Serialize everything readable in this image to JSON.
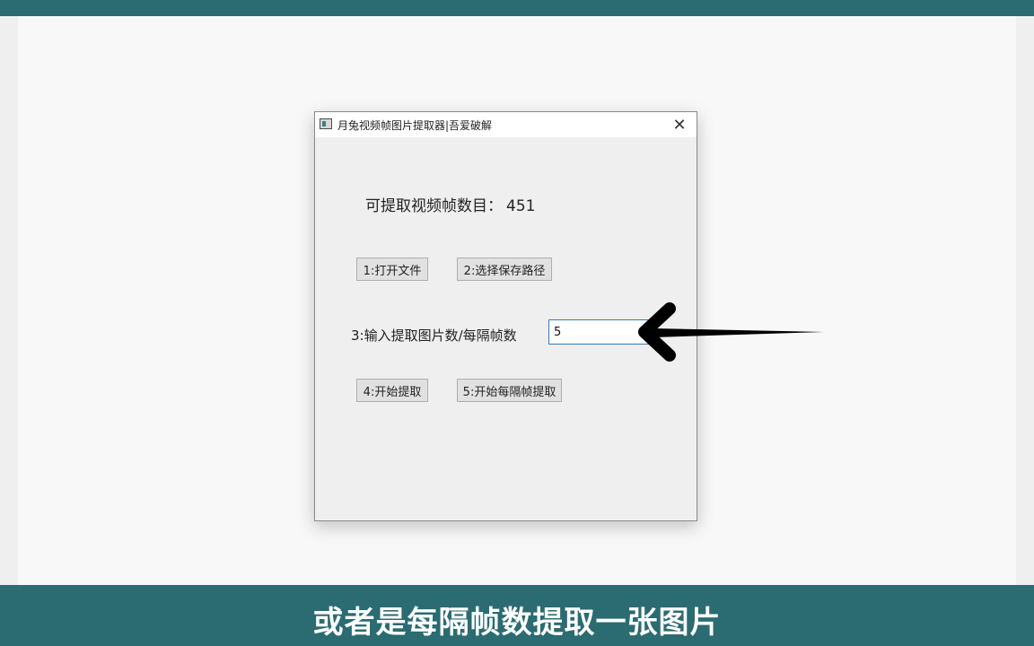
{
  "window": {
    "title": "月兔视频帧图片提取器|吾爱破解",
    "close_glyph": "✕"
  },
  "info": {
    "frame_count_label": "可提取视频帧数目：",
    "frame_count_value": "451"
  },
  "buttons": {
    "open_file": "1:打开文件",
    "select_save_path": "2:选择保存路径",
    "start_extract": "4:开始提取",
    "start_every_frame": "5:开始每隔帧提取"
  },
  "input": {
    "label": "3:输入提取图片数/每隔帧数",
    "value": "5"
  },
  "subtitle": {
    "text": "或者是每隔帧数提取一张图片"
  },
  "icons": {
    "app": "app-window-icon",
    "close": "close-icon",
    "pointer": "arrow-pointer-icon"
  },
  "colors": {
    "band": "#2b6b72",
    "input_focus_border": "#2e7bc4",
    "window_bg": "#efefef"
  }
}
